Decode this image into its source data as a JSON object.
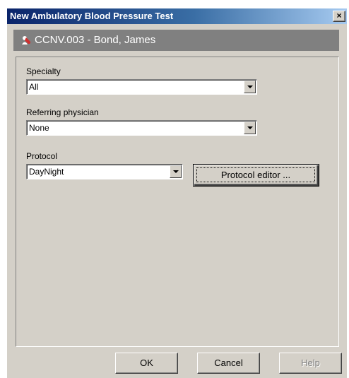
{
  "window": {
    "title": "New Ambulatory Blood Pressure Test",
    "close_symbol": "×"
  },
  "patient": {
    "label": "CCNV.003 - Bond, James",
    "icon": "patient-icon"
  },
  "form": {
    "specialty": {
      "label": "Specialty",
      "value": "All"
    },
    "referring_physician": {
      "label": "Referring physician",
      "value": "None"
    },
    "protocol": {
      "label": "Protocol",
      "value": "DayNight"
    },
    "protocol_editor_label": "Protocol editor ..."
  },
  "footer": {
    "ok_label": "OK",
    "cancel_label": "Cancel",
    "help_label": "Help"
  },
  "colors": {
    "title_gradient_start": "#0a246a",
    "title_gradient_end": "#a6caf0",
    "dialog_face": "#d4d0c8",
    "patient_bar": "#808080",
    "icon_accent": "#d03030"
  }
}
